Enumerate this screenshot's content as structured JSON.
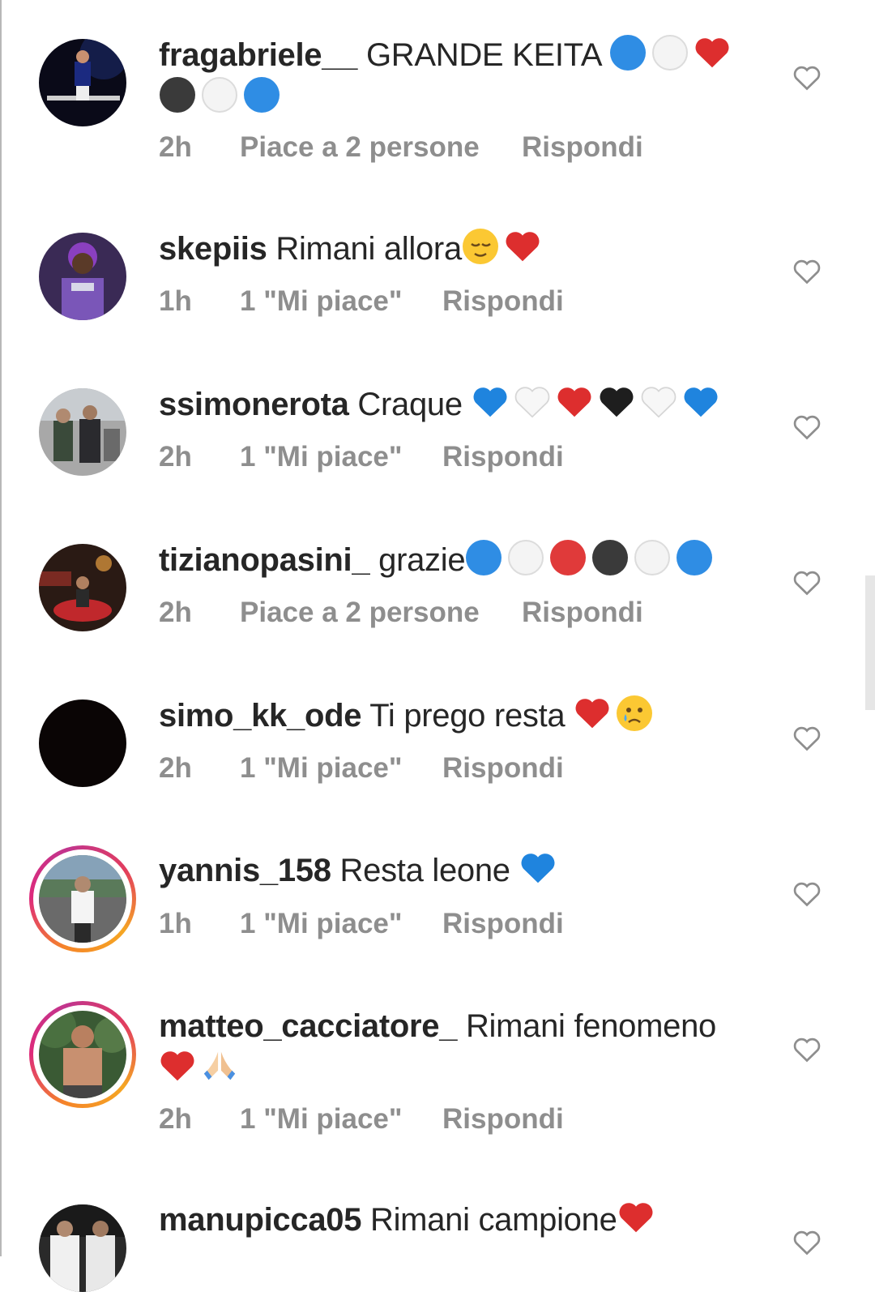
{
  "comments": [
    {
      "username": "fragabriele__",
      "text": "GRANDE KEITA",
      "emoji": [
        "blue-circle",
        "white-circle",
        "red-heart",
        "black-circle",
        "white-circle",
        "blue-circle"
      ],
      "time": "2h",
      "likes": "Piace a 2 persone",
      "reply": "Rispondi",
      "story_ring": false
    },
    {
      "username": "skepiis",
      "text": "Rimani allora",
      "emoji": [
        "relieved-face",
        "red-heart"
      ],
      "time": "1h",
      "likes": "1 \"Mi piace\"",
      "reply": "Rispondi",
      "story_ring": false
    },
    {
      "username": "ssimonerota",
      "text": "Craque",
      "emoji": [
        "blue-heart",
        "white-heart",
        "red-heart",
        "black-heart",
        "white-heart",
        "blue-heart"
      ],
      "time": "2h",
      "likes": "1 \"Mi piace\"",
      "reply": "Rispondi",
      "story_ring": false
    },
    {
      "username": "tizianopasini_",
      "text": "grazie",
      "emoji": [
        "blue-circle",
        "white-circle",
        "red-circle",
        "black-circle",
        "white-circle",
        "blue-circle"
      ],
      "time": "2h",
      "likes": "Piace a 2 persone",
      "reply": "Rispondi",
      "story_ring": false
    },
    {
      "username": "simo_kk_ode",
      "text": "Ti prego resta",
      "emoji": [
        "red-heart",
        "crying-face"
      ],
      "time": "2h",
      "likes": "1 \"Mi piace\"",
      "reply": "Rispondi",
      "story_ring": false
    },
    {
      "username": "yannis_158",
      "text": "Resta leone",
      "emoji": [
        "blue-heart"
      ],
      "time": "1h",
      "likes": "1 \"Mi piace\"",
      "reply": "Rispondi",
      "story_ring": true
    },
    {
      "username": "matteo_cacciatore_",
      "text": "Rimani fenomeno",
      "emoji": [
        "red-heart",
        "folded-hands"
      ],
      "time": "2h",
      "likes": "1 \"Mi piace\"",
      "reply": "Rispondi",
      "story_ring": true
    },
    {
      "username": "manupicca05",
      "text": "Rimani campione",
      "emoji": [
        "red-heart"
      ],
      "time": "",
      "likes": "",
      "reply": "",
      "story_ring": false
    }
  ],
  "colors": {
    "text": "#262626",
    "meta": "#8e8e8e",
    "ring_start": "#f58529",
    "ring_end": "#dd2a7b"
  }
}
